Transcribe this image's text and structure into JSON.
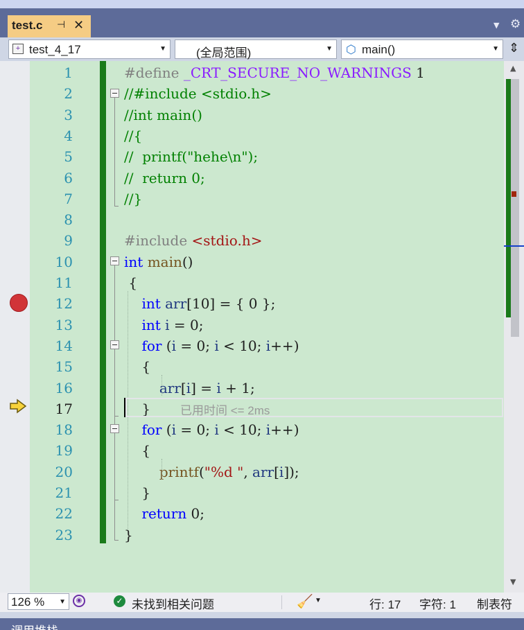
{
  "tab": {
    "filename": "test.c",
    "pin_icon": "pin-icon",
    "close_icon": "close-icon"
  },
  "navbar": {
    "project": "test_4_17",
    "scope": "(全局范围)",
    "member": "main()"
  },
  "editor": {
    "line_numbers": [
      "1",
      "2",
      "3",
      "4",
      "5",
      "6",
      "7",
      "8",
      "9",
      "10",
      "11",
      "12",
      "13",
      "14",
      "15",
      "16",
      "17",
      "18",
      "19",
      "20",
      "21",
      "22",
      "23"
    ],
    "current_line": "17",
    "breakpoint_line": "12",
    "lines": [
      [
        {
          "t": "#define ",
          "c": "pp"
        },
        {
          "t": "_CRT_SECURE_NO_WARNINGS",
          "c": "mac"
        },
        {
          "t": " 1",
          "c": ""
        }
      ],
      [
        {
          "t": "//#include <stdio.h>",
          "c": "cm"
        }
      ],
      [
        {
          "t": "//int main()",
          "c": "cm"
        }
      ],
      [
        {
          "t": "//{",
          "c": "cm"
        }
      ],
      [
        {
          "t": "//  printf(\"hehe\\n\");",
          "c": "cm"
        }
      ],
      [
        {
          "t": "//  return 0;",
          "c": "cm"
        }
      ],
      [
        {
          "t": "//}",
          "c": "cm"
        }
      ],
      [],
      [
        {
          "t": "#include ",
          "c": "pp"
        },
        {
          "t": "<stdio.h>",
          "c": "str"
        }
      ],
      [
        {
          "t": "int",
          "c": "kw"
        },
        {
          "t": " ",
          "c": ""
        },
        {
          "t": "main",
          "c": "fn"
        },
        {
          "t": "()",
          "c": ""
        }
      ],
      [
        {
          "t": " {",
          "c": ""
        }
      ],
      [
        {
          "t": "    ",
          "c": ""
        },
        {
          "t": "int",
          "c": "kw"
        },
        {
          "t": " ",
          "c": ""
        },
        {
          "t": "arr",
          "c": "var"
        },
        {
          "t": "[10] = { 0 };",
          "c": ""
        }
      ],
      [
        {
          "t": "    ",
          "c": ""
        },
        {
          "t": "int",
          "c": "kw"
        },
        {
          "t": " ",
          "c": ""
        },
        {
          "t": "i",
          "c": "var"
        },
        {
          "t": " = 0;",
          "c": ""
        }
      ],
      [
        {
          "t": "    ",
          "c": ""
        },
        {
          "t": "for",
          "c": "kw"
        },
        {
          "t": " (",
          "c": ""
        },
        {
          "t": "i",
          "c": "var"
        },
        {
          "t": " = 0; ",
          "c": ""
        },
        {
          "t": "i",
          "c": "var"
        },
        {
          "t": " < 10; ",
          "c": ""
        },
        {
          "t": "i",
          "c": "var"
        },
        {
          "t": "++)",
          "c": ""
        }
      ],
      [
        {
          "t": "    {",
          "c": ""
        }
      ],
      [
        {
          "t": "        ",
          "c": ""
        },
        {
          "t": "arr",
          "c": "var"
        },
        {
          "t": "[",
          "c": ""
        },
        {
          "t": "i",
          "c": "var"
        },
        {
          "t": "] = ",
          "c": ""
        },
        {
          "t": "i",
          "c": "var"
        },
        {
          "t": " + 1;",
          "c": ""
        }
      ],
      [
        {
          "t": "    }",
          "c": ""
        }
      ],
      [
        {
          "t": "    ",
          "c": ""
        },
        {
          "t": "for",
          "c": "kw"
        },
        {
          "t": " (",
          "c": ""
        },
        {
          "t": "i",
          "c": "var"
        },
        {
          "t": " = 0; ",
          "c": ""
        },
        {
          "t": "i",
          "c": "var"
        },
        {
          "t": " < 10; ",
          "c": ""
        },
        {
          "t": "i",
          "c": "var"
        },
        {
          "t": "++)",
          "c": ""
        }
      ],
      [
        {
          "t": "    {",
          "c": ""
        }
      ],
      [
        {
          "t": "        ",
          "c": ""
        },
        {
          "t": "printf",
          "c": "fn"
        },
        {
          "t": "(",
          "c": ""
        },
        {
          "t": "\"%d \"",
          "c": "str"
        },
        {
          "t": ", ",
          "c": ""
        },
        {
          "t": "arr",
          "c": "var"
        },
        {
          "t": "[",
          "c": ""
        },
        {
          "t": "i",
          "c": "var"
        },
        {
          "t": "]);",
          "c": ""
        }
      ],
      [
        {
          "t": "    }",
          "c": ""
        }
      ],
      [
        {
          "t": "    ",
          "c": ""
        },
        {
          "t": "return",
          "c": "kw"
        },
        {
          "t": " 0;",
          "c": ""
        }
      ],
      [
        {
          "t": "}",
          "c": ""
        }
      ]
    ],
    "perf_tip": "已用时间 <= 2ms"
  },
  "statusbar": {
    "zoom": "126 %",
    "issues": "未找到相关问题",
    "row": "行: 17",
    "col": "字符: 1",
    "indent": "制表符"
  },
  "bottom_panel": {
    "title": "调用堆栈"
  },
  "colors": {
    "editor_bg": "#cce8cf",
    "keyword": "#0000ff",
    "comment": "#008000",
    "string": "#a31515",
    "macro": "#8a1bff",
    "line_number": "#2b91af",
    "change_bar": "#1a7a1a",
    "breakpoint": "#d13438",
    "tab_active": "#f5cc84"
  }
}
